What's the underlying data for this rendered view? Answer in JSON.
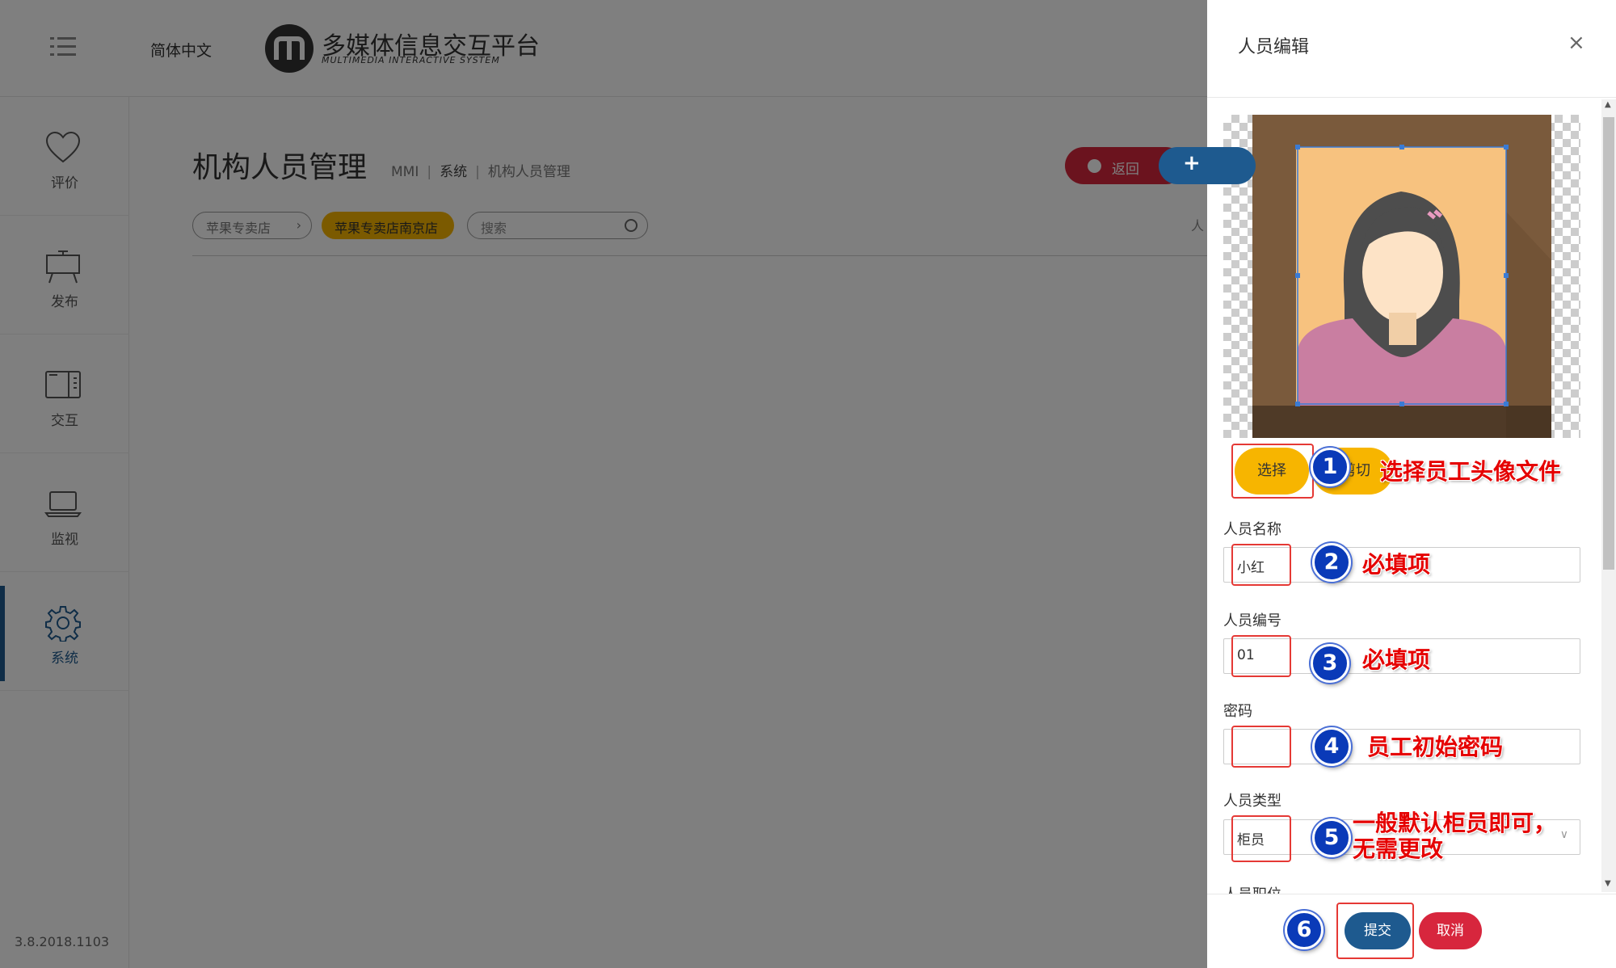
{
  "topbar": {
    "language": "简体中文",
    "logo_title": "多媒体信息交互平台",
    "logo_subtitle": "MULTIMEDIA INTERACTIVE SYSTEM"
  },
  "sidebar": {
    "items": [
      {
        "label": "评价",
        "icon": "heart-icon"
      },
      {
        "label": "发布",
        "icon": "easel-board-icon"
      },
      {
        "label": "交互",
        "icon": "tablet-icon"
      },
      {
        "label": "监视",
        "icon": "laptop-icon"
      },
      {
        "label": "系统",
        "icon": "gear-icon",
        "active": true
      }
    ],
    "version": "3.8.2018.1103"
  },
  "main": {
    "title": "机构人员管理",
    "breadcrumb": [
      "MMI",
      "系统",
      "机构人员管理"
    ],
    "back_button": "返回",
    "add_button": "+",
    "store_filter": "苹果专卖店",
    "branch_filter": "苹果专卖店南京店",
    "search_placeholder": "搜索",
    "cut_text": "人"
  },
  "drawer": {
    "title": "人员编辑",
    "close": "×",
    "choose_button": "选择",
    "crop_button": "剪切",
    "fields": {
      "name": {
        "label": "人员名称",
        "value": "小红"
      },
      "number": {
        "label": "人员编号",
        "value": "01"
      },
      "password": {
        "label": "密码",
        "value": ""
      },
      "type": {
        "label": "人员类型",
        "value": "柜员"
      },
      "position": {
        "label": "人员职位"
      }
    },
    "submit_button": "提交",
    "cancel_button": "取消"
  },
  "annotations": [
    {
      "number": "1",
      "text": "选择员工头像文件"
    },
    {
      "number": "2",
      "text": "必填项"
    },
    {
      "number": "3",
      "text": "必填项"
    },
    {
      "number": "4",
      "text": "员工初始密码"
    },
    {
      "number": "5",
      "text_line1": "一般默认柜员即可，",
      "text_line2": "无需更改"
    },
    {
      "number": "6"
    }
  ],
  "colors": {
    "primary": "#1e5a8f",
    "danger": "#d7263d",
    "accent": "#f7b500",
    "annotation_red": "#e50000",
    "annotation_badge": "#0a3ab8"
  }
}
